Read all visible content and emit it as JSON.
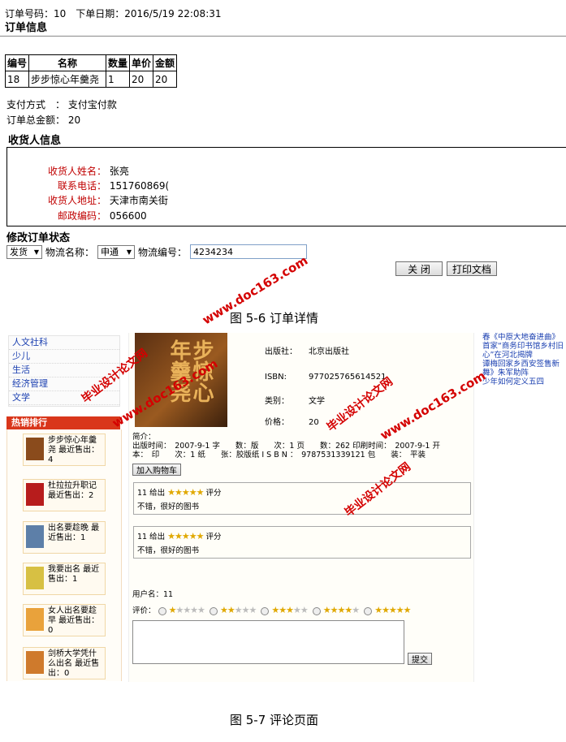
{
  "order": {
    "header_line": "订单号码：10　下单日期：2016/5/19 22:08:31",
    "section_title": "订单信息",
    "table_headers": [
      "编号",
      "名称",
      "数量",
      "单价",
      "金额"
    ],
    "table_row": [
      "18",
      "步步惊心年羹尧",
      "1",
      "20",
      "20"
    ],
    "payment_label": "支付方式　：",
    "payment_value": "支付宝付款",
    "total_label": "订单总金额：",
    "total_value": "20"
  },
  "recipient": {
    "section_title": "收货人信息",
    "name_label": "收货人姓名：",
    "name_value": "张亮",
    "phone_label": "联系电话：",
    "phone_value": "151760869(",
    "address_label": "收货人地址：",
    "address_value": "天津市南关街",
    "zip_label": "邮政编码：",
    "zip_value": "056600"
  },
  "status": {
    "section_title": "修改订单状态",
    "status_select": "发货",
    "logistics_name_label": "物流名称：",
    "logistics_select": "申通",
    "logistics_no_label": "物流编号：",
    "logistics_no_value": "4234234",
    "close_button": "关 闭",
    "print_button": "打印文档"
  },
  "caption1": "图 5-6 订单详情",
  "caption2": "图 5-7 评论页面",
  "watermarks": {
    "url": "www.doc163.com",
    "site": "毕业设计论文网"
  },
  "store": {
    "categories": [
      "人文社科",
      "少儿",
      "生活",
      "经济管理",
      "文学"
    ],
    "hot_title": "热销排行",
    "hot_items": [
      {
        "text": "步步惊心年羹尧 最近售出：4",
        "color": "#8a4b1c"
      },
      {
        "text": "杜拉拉升职记 最近售出：2",
        "color": "#b71c1c"
      },
      {
        "text": "出名要趁晚 最近售出：1",
        "color": "#5d7fa8"
      },
      {
        "text": "我要出名 最近售出：1",
        "color": "#d7c043"
      },
      {
        "text": "女人出名要趁早 最近售出：0",
        "color": "#e9a23b"
      },
      {
        "text": "剑桥大学凭什么出名 最近售出：0",
        "color": "#cf7a2c"
      }
    ],
    "book_cover_text": "步惊心 年羹尧",
    "book": {
      "publisher_label": "出版社：",
      "publisher_value": "北京出版社",
      "isbn_label": "ISBN:",
      "isbn_value": "977025765614521",
      "category_label": "类别：",
      "category_value": "文学",
      "price_label": "价格：",
      "price_value": "20",
      "intro_label": "简介：",
      "intro_line1": "出版时间：　2007-9-1 字　　数：版　　次：1 页　　数：262 印刷时间：　2007-9-1 开",
      "intro_line2": "本：　印　　次：1 纸　　张：胶版纸 I S B N ：　9787531339121 包　　装：　平装"
    },
    "add_cart_button": "加入购物车",
    "reviews": [
      {
        "head": "11  给出",
        "stars": "★★★★★",
        "tail": "评分",
        "body": "不错，很好的图书"
      },
      {
        "head": "11  给出",
        "stars": "★★★★★",
        "tail": "评分",
        "body": "不错，很好的图书"
      }
    ],
    "username_line": "用户名：11",
    "rating_label": "评价：",
    "submit_button": "提交",
    "news": [
      "春《中原大地奋进曲》",
      "首家“商务印书馆乡村旧",
      "心”在河北揭牌",
      "谭梅回家乡西安签售新",
      "舞》朱军助阵",
      "少年如何定义五四"
    ],
    "accent_color": "#d9361b",
    "link_color": "#1a3fb0"
  }
}
